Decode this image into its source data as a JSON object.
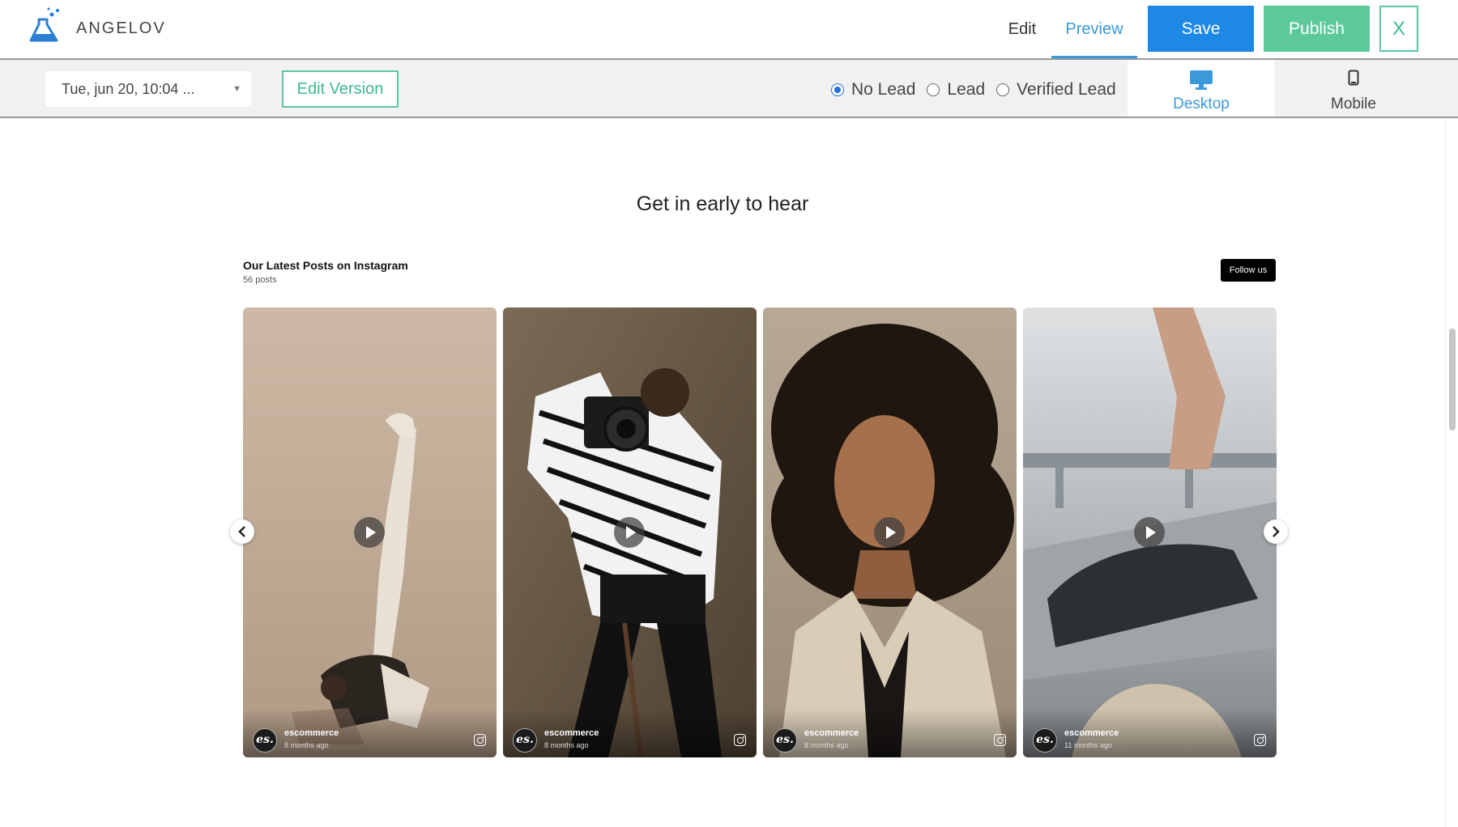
{
  "header": {
    "brand": "ANGELOV",
    "logo_icon": "flask-icon",
    "nav": {
      "edit": "Edit",
      "preview": "Preview",
      "active": "Preview"
    },
    "save_label": "Save",
    "publish_label": "Publish",
    "close_label": "X",
    "colors": {
      "save": "#1e88e5",
      "publish": "#5cc99b",
      "active_tab": "#3a9ad9"
    }
  },
  "toolbar": {
    "version": "Tue, jun 20, 10:04 ...",
    "edit_version_label": "Edit Version",
    "lead_options": [
      "No Lead",
      "Lead",
      "Verified Lead"
    ],
    "lead_selected": "No Lead",
    "devices": {
      "desktop": "Desktop",
      "mobile": "Mobile",
      "active": "Desktop"
    }
  },
  "page": {
    "heading": "Get in early to hear",
    "instagram": {
      "title": "Our Latest Posts on Instagram",
      "count": "56 posts",
      "follow_label": "Follow us",
      "posts": [
        {
          "user": "escommerce",
          "time": "8 months ago",
          "avatar": "es."
        },
        {
          "user": "escommerce",
          "time": "8 months ago",
          "avatar": "es."
        },
        {
          "user": "escommerce",
          "time": "8 months ago",
          "avatar": "es."
        },
        {
          "user": "escommerce",
          "time": "11 months ago",
          "avatar": "es."
        }
      ]
    }
  }
}
